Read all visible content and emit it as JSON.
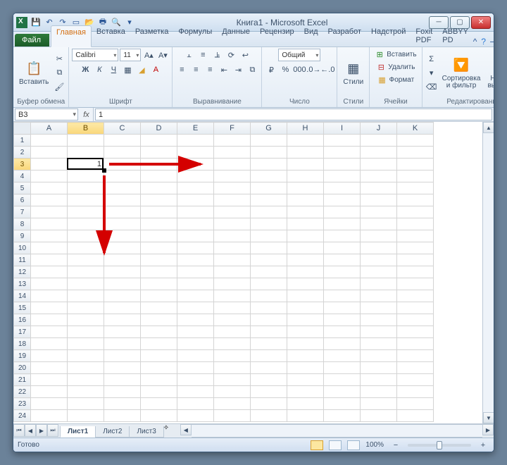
{
  "title": "Книга1 - Microsoft Excel",
  "qat": [
    "save",
    "undo",
    "redo",
    "new",
    "open",
    "quickprint",
    "preview",
    "spelling",
    "more"
  ],
  "tabs": {
    "file": "Файл",
    "items": [
      "Главная",
      "Вставка",
      "Разметка",
      "Формулы",
      "Данные",
      "Рецензир",
      "Вид",
      "Разработ",
      "Надстрой",
      "Foxit PDF",
      "ABBYY PD"
    ],
    "active": 0
  },
  "ribbon": {
    "clipboard": {
      "label": "Буфер обмена",
      "paste": "Вставить"
    },
    "font": {
      "label": "Шрифт",
      "name": "Calibri",
      "size": "11"
    },
    "align": {
      "label": "Выравнивание"
    },
    "number": {
      "label": "Число",
      "format": "Общий"
    },
    "styles": {
      "label": "Стили",
      "btn": "Стили"
    },
    "cells": {
      "label": "Ячейки",
      "insert": "Вставить",
      "delete": "Удалить",
      "format": "Формат"
    },
    "editing": {
      "label": "Редактирование",
      "sort": "Сортировка\nи фильтр",
      "find": "Найти и\nвыделить"
    }
  },
  "namebox": "B3",
  "formula": "1",
  "columns": [
    "A",
    "B",
    "C",
    "D",
    "E",
    "F",
    "G",
    "H",
    "I",
    "J",
    "K"
  ],
  "rows": 24,
  "activeCol": 1,
  "activeRow": 2,
  "cellValue": "1",
  "sheets": [
    "Лист1",
    "Лист2",
    "Лист3"
  ],
  "activeSheet": 0,
  "status": {
    "ready": "Готово",
    "zoom": "100%"
  }
}
